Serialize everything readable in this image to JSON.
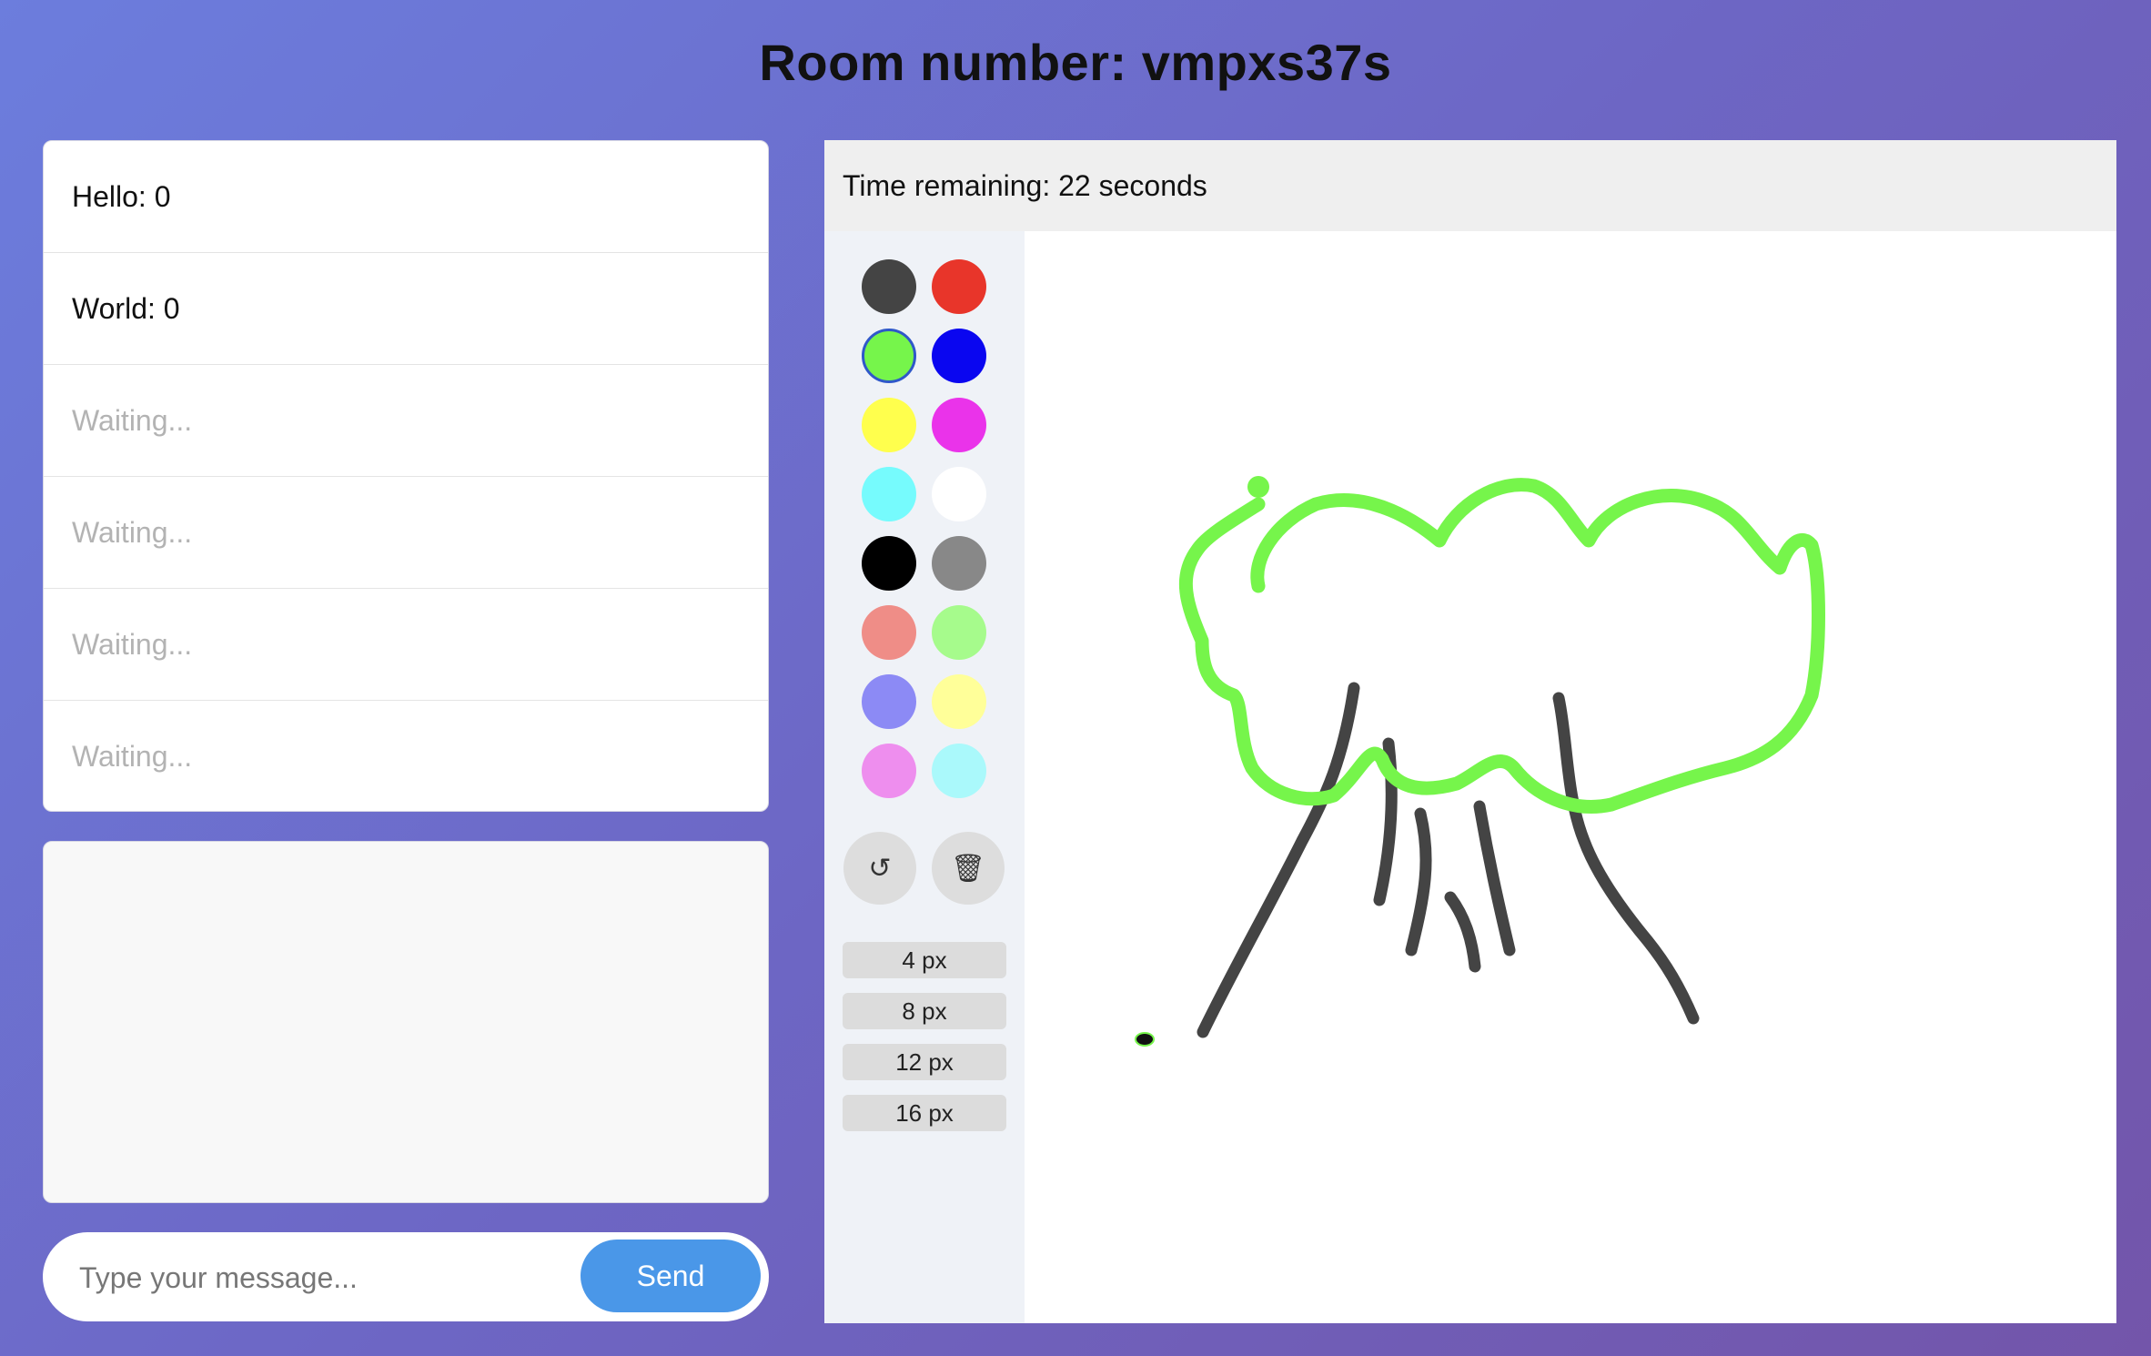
{
  "room": {
    "title": "Room number: vmpxs37s"
  },
  "players": [
    {
      "text": "Hello: 0",
      "waiting": false
    },
    {
      "text": "World: 0",
      "waiting": false
    },
    {
      "text": "Waiting...",
      "waiting": true
    },
    {
      "text": "Waiting...",
      "waiting": true
    },
    {
      "text": "Waiting...",
      "waiting": true
    },
    {
      "text": "Waiting...",
      "waiting": true
    }
  ],
  "chat": {
    "placeholder": "Type your message...",
    "send_label": "Send"
  },
  "game": {
    "timer_text": "Time remaining: 22 seconds",
    "palette": [
      "#444444",
      "#e8352a",
      "#76f54b",
      "#0a06f0",
      "#ffff4d",
      "#ea33ea",
      "#76fbfd",
      "#ffffff",
      "#000000",
      "#888888",
      "#ef8d87",
      "#a6fb8c",
      "#8c8af5",
      "#ffff99",
      "#ee8eee",
      "#aaf9fb"
    ],
    "selected_color": "#76f54b",
    "tools": {
      "undo_icon": "↺",
      "clear_icon": "🗑"
    },
    "brush_sizes": [
      "4 px",
      "8 px",
      "12 px",
      "16 px"
    ]
  }
}
